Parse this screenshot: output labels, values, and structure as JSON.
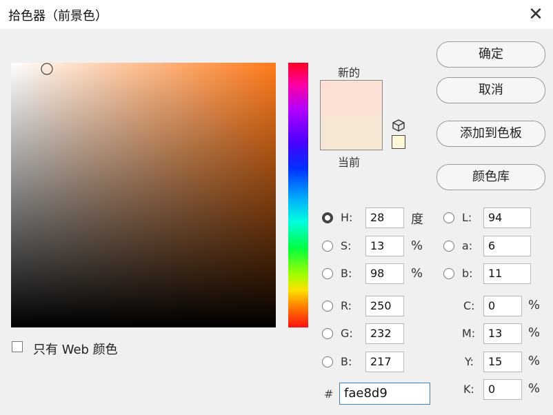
{
  "window": {
    "title": "拾色器（前景色）"
  },
  "picker": {
    "new_label": "新的",
    "current_label": "当前",
    "new_color": "#fce0d6",
    "current_color": "#f5e7d4"
  },
  "buttons": {
    "ok": "确定",
    "cancel": "取消",
    "add_swatch": "添加到色板",
    "color_library": "颜色库"
  },
  "hsb": {
    "h": {
      "label": "H:",
      "value": "28",
      "unit": "度"
    },
    "s": {
      "label": "S:",
      "value": "13",
      "unit": "%"
    },
    "b": {
      "label": "B:",
      "value": "98",
      "unit": "%"
    }
  },
  "rgb": {
    "r": {
      "label": "R:",
      "value": "250"
    },
    "g": {
      "label": "G:",
      "value": "232"
    },
    "b": {
      "label": "B:",
      "value": "217"
    }
  },
  "lab": {
    "l": {
      "label": "L:",
      "value": "94"
    },
    "a": {
      "label": "a:",
      "value": "6"
    },
    "b": {
      "label": "b:",
      "value": "11"
    }
  },
  "cmyk": {
    "c": {
      "label": "C:",
      "value": "0",
      "unit": "%"
    },
    "m": {
      "label": "M:",
      "value": "13",
      "unit": "%"
    },
    "y": {
      "label": "Y:",
      "value": "15",
      "unit": "%"
    },
    "k": {
      "label": "K:",
      "value": "0",
      "unit": "%"
    }
  },
  "hex": {
    "symbol": "#",
    "value": "fae8d9"
  },
  "web_only": {
    "label": "只有 Web 颜色",
    "checked": false
  },
  "icons": {
    "close": "close-icon",
    "cube": "cube-icon"
  }
}
